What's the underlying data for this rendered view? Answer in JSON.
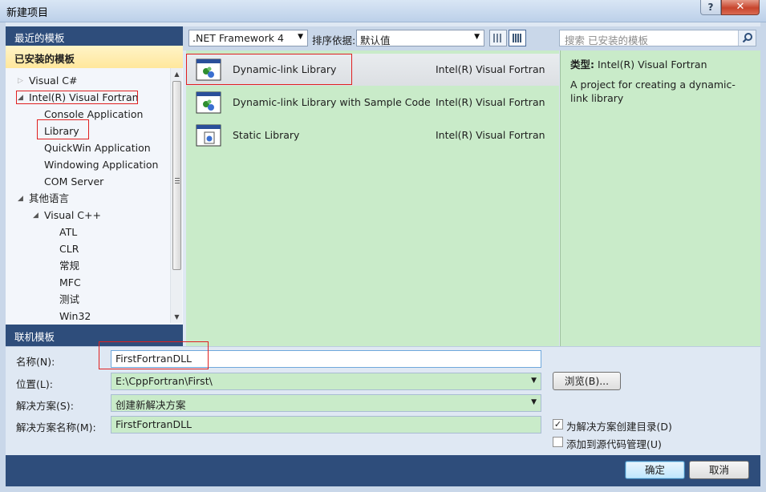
{
  "window": {
    "title": "新建项目",
    "help_label": "?",
    "close_label": "✕"
  },
  "nav": {
    "recent_label": "最近的模板",
    "installed_label": "已安装的模板",
    "online_label": "联机模板",
    "tree": [
      {
        "label": "Visual C#",
        "arrow": "▷"
      },
      {
        "label": "Intel(R) Visual Fortran",
        "arrow": "◢"
      },
      {
        "label": "Console Application",
        "arrow": ""
      },
      {
        "label": "Library",
        "arrow": ""
      },
      {
        "label": "QuickWin Application",
        "arrow": ""
      },
      {
        "label": "Windowing Application",
        "arrow": ""
      },
      {
        "label": "COM Server",
        "arrow": ""
      },
      {
        "label": "其他语言",
        "arrow": "◢"
      },
      {
        "label": "Visual C++",
        "arrow": "◢"
      },
      {
        "label": "ATL",
        "arrow": ""
      },
      {
        "label": "CLR",
        "arrow": ""
      },
      {
        "label": "常规",
        "arrow": ""
      },
      {
        "label": "MFC",
        "arrow": ""
      },
      {
        "label": "测试",
        "arrow": ""
      },
      {
        "label": "Win32",
        "arrow": ""
      }
    ]
  },
  "toolbar": {
    "framework": ".NET Framework 4",
    "sort_label": "排序依据:",
    "sort_value": "默认值",
    "search_placeholder": "搜索 已安装的模板"
  },
  "templates": [
    {
      "name": "Dynamic-link Library",
      "language": "Intel(R) Visual Fortran"
    },
    {
      "name": "Dynamic-link Library with Sample Code",
      "language": "Intel(R) Visual Fortran"
    },
    {
      "name": "Static Library",
      "language": "Intel(R) Visual Fortran"
    }
  ],
  "details": {
    "type_label": "类型:",
    "type_value": "Intel(R) Visual Fortran",
    "description": "A project for creating a dynamic-link library"
  },
  "form": {
    "name_label": "名称(N):",
    "name_value": "FirstFortranDLL",
    "location_label": "位置(L):",
    "location_value": "E:\\CppFortran\\First\\",
    "browse_label": "浏览(B)...",
    "solution_label": "解决方案(S):",
    "solution_value": "创建新解决方案",
    "solution_name_label": "解决方案名称(M):",
    "solution_name_value": "FirstFortranDLL",
    "create_dir_label": "为解决方案创建目录(D)",
    "create_dir_checked": true,
    "source_control_label": "添加到源代码管理(U)",
    "source_control_checked": false
  },
  "buttons": {
    "ok": "确定",
    "cancel": "取消"
  }
}
